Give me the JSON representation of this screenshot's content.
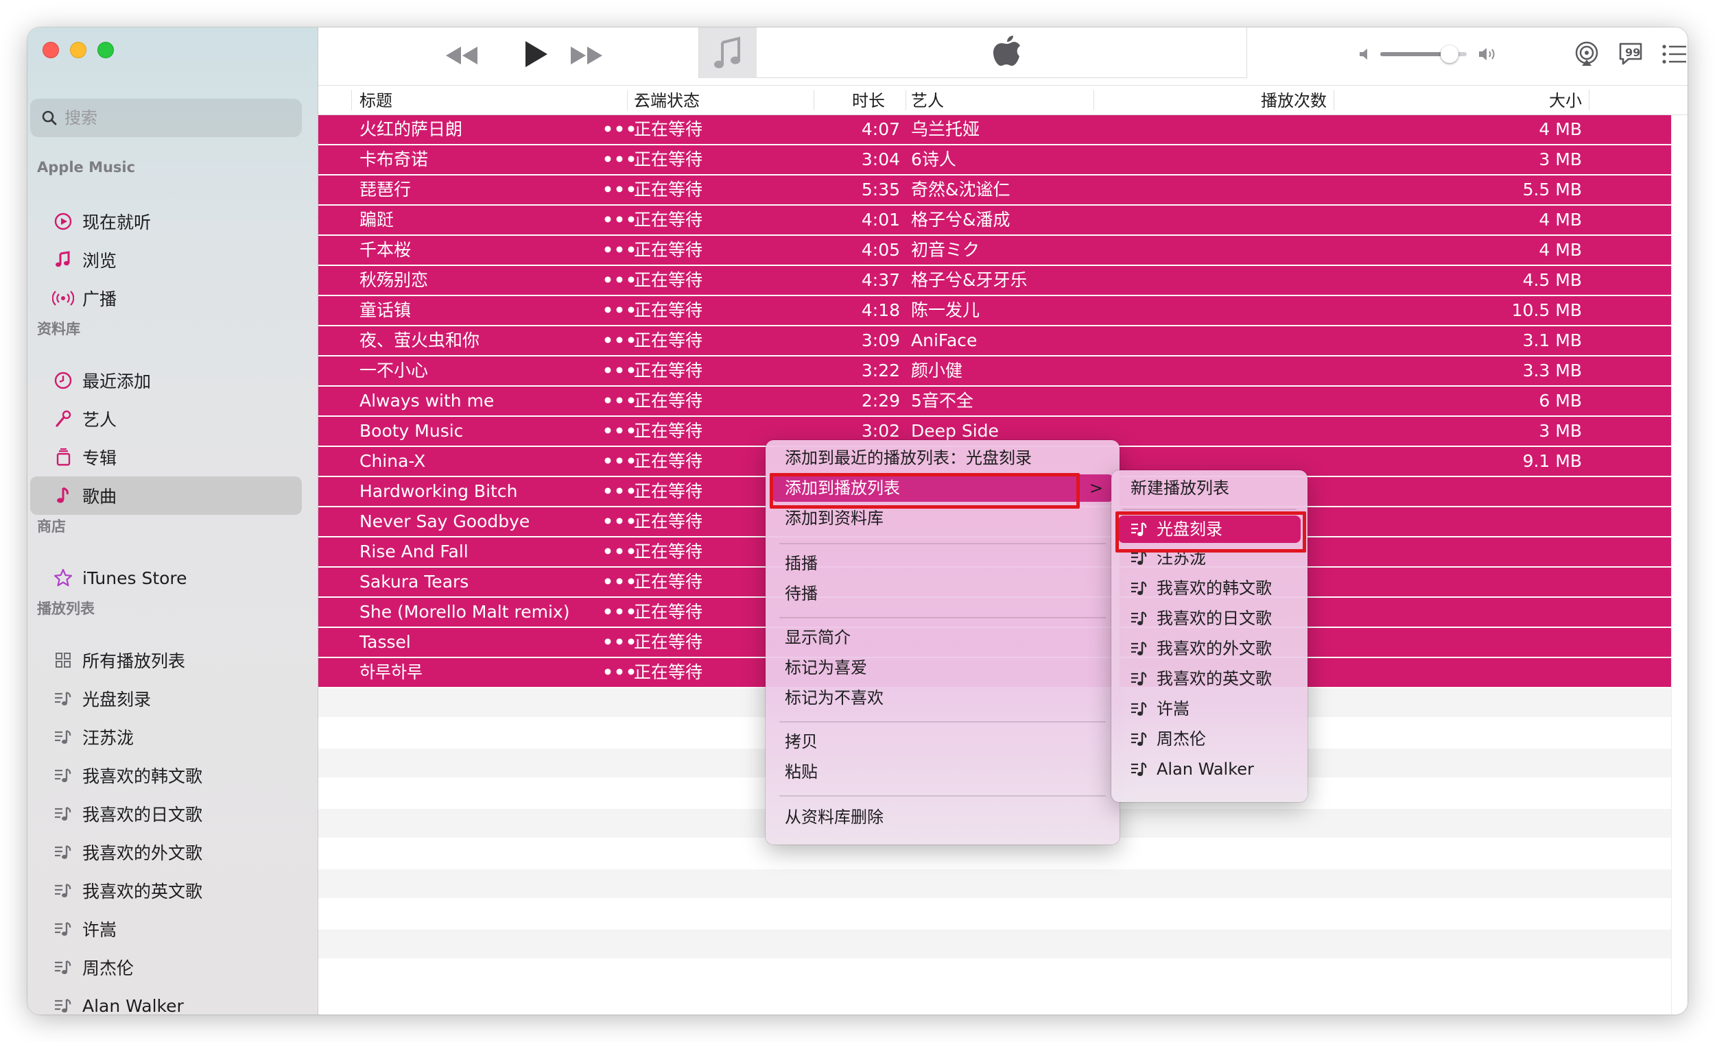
{
  "colors": {
    "accent": "#d11a6e",
    "highlight_box": "#e0151f",
    "sidebar_bg": "#e4e4e6",
    "traffic_red": "#ff5f57",
    "traffic_yellow": "#febc2e",
    "traffic_green": "#28c840"
  },
  "sidebar": {
    "search_placeholder": "搜索",
    "sections": [
      {
        "title": "Apple Music",
        "items": [
          {
            "label": "现在就听",
            "icon": "play-circle-icon"
          },
          {
            "label": "浏览",
            "icon": "music-note-icon"
          },
          {
            "label": "广播",
            "icon": "radio-waves-icon"
          }
        ]
      },
      {
        "title": "资料库",
        "items": [
          {
            "label": "最近添加",
            "icon": "clock-icon"
          },
          {
            "label": "艺人",
            "icon": "microphone-icon"
          },
          {
            "label": "专辑",
            "icon": "album-stack-icon"
          },
          {
            "label": "歌曲",
            "icon": "music-note-icon",
            "selected": true
          }
        ]
      },
      {
        "title": "商店",
        "items": [
          {
            "label": "iTunes Store",
            "icon": "star-icon"
          }
        ]
      },
      {
        "title": "播放列表",
        "items": [
          {
            "label": "所有播放列表",
            "icon": "grid-icon"
          },
          {
            "label": "光盘刻录",
            "icon": "playlist-icon"
          },
          {
            "label": "汪苏泷",
            "icon": "playlist-icon"
          },
          {
            "label": "我喜欢的韩文歌",
            "icon": "playlist-icon"
          },
          {
            "label": "我喜欢的日文歌",
            "icon": "playlist-icon"
          },
          {
            "label": "我喜欢的外文歌",
            "icon": "playlist-icon"
          },
          {
            "label": "我喜欢的英文歌",
            "icon": "playlist-icon"
          },
          {
            "label": "许嵩",
            "icon": "playlist-icon"
          },
          {
            "label": "周杰伦",
            "icon": "playlist-icon"
          },
          {
            "label": "Alan Walker",
            "icon": "playlist-icon"
          }
        ]
      }
    ]
  },
  "toolbar": {
    "volume_level": 0.8
  },
  "columns": {
    "title": "标题",
    "sort_indicator": "^",
    "cloud_status": "云端状态",
    "duration": "时长",
    "artist": "艺人",
    "plays": "播放次数",
    "size": "大小"
  },
  "tracks": [
    {
      "title": "火红的萨日朗",
      "status": "正在等待",
      "duration": "4:07",
      "artist": "乌兰托娅",
      "size": "4 MB"
    },
    {
      "title": "卡布奇诺",
      "status": "正在等待",
      "duration": "3:04",
      "artist": "6诗人",
      "size": "3 MB"
    },
    {
      "title": "琵琶行",
      "status": "正在等待",
      "duration": "5:35",
      "artist": "奇然&沈谧仁",
      "size": "5.5 MB"
    },
    {
      "title": "蹁跹",
      "status": "正在等待",
      "duration": "4:01",
      "artist": "格子兮&潘成",
      "size": "4 MB"
    },
    {
      "title": "千本桜",
      "status": "正在等待",
      "duration": "4:05",
      "artist": "初音ミク",
      "size": "4 MB"
    },
    {
      "title": "秋殇别恋",
      "status": "正在等待",
      "duration": "4:37",
      "artist": "格子兮&牙牙乐",
      "size": "4.5 MB"
    },
    {
      "title": "童话镇",
      "status": "正在等待",
      "duration": "4:18",
      "artist": "陈一发儿",
      "size": "10.5 MB"
    },
    {
      "title": "夜、萤火虫和你",
      "status": "正在等待",
      "duration": "3:09",
      "artist": "AniFace",
      "size": "3.1 MB"
    },
    {
      "title": "一不小心",
      "status": "正在等待",
      "duration": "3:22",
      "artist": "颜小健",
      "size": "3.3 MB"
    },
    {
      "title": "Always with me",
      "status": "正在等待",
      "duration": "2:29",
      "artist": "5音不全",
      "size": "6 MB"
    },
    {
      "title": "Booty Music",
      "status": "正在等待",
      "duration": "3:02",
      "artist": "Deep Side",
      "size": "3 MB"
    },
    {
      "title": "China-X",
      "status": "正在等待",
      "duration": "",
      "artist": "",
      "size": "9.1 MB"
    },
    {
      "title": "Hardworking Bitch",
      "status": "正在等待",
      "duration": "",
      "artist": "",
      "size": ""
    },
    {
      "title": "Never Say Goodbye",
      "status": "正在等待",
      "duration": "",
      "artist": "",
      "size": ""
    },
    {
      "title": "Rise And Fall",
      "status": "正在等待",
      "duration": "",
      "artist": "",
      "size": ""
    },
    {
      "title": "Sakura Tears",
      "status": "正在等待",
      "duration": "",
      "artist": "",
      "size": ""
    },
    {
      "title": "She (Morello Malt remix)",
      "status": "正在等待",
      "duration": "",
      "artist": "",
      "size": ""
    },
    {
      "title": "Tassel",
      "status": "正在等待",
      "duration": "",
      "artist": "",
      "size": ""
    },
    {
      "title": "하루하루",
      "status": "正在等待",
      "duration": "",
      "artist": "",
      "size": ""
    }
  ],
  "more_glyph": "•••",
  "context_menu": {
    "add_to_recent": "添加到最近的播放列表：光盘刻录",
    "add_to_playlist": "添加到播放列表",
    "add_to_library": "添加到资料库",
    "play_next": "插播",
    "play_later": "待播",
    "get_info": "显示简介",
    "love": "标记为喜爱",
    "dislike": "标记为不喜欢",
    "copy": "拷贝",
    "paste": "粘贴",
    "delete_from_library": "从资料库删除",
    "submenu_chevron": ">"
  },
  "playlist_submenu": {
    "new_playlist": "新建播放列表",
    "playlists": [
      "光盘刻录",
      "汪苏泷",
      "我喜欢的韩文歌",
      "我喜欢的日文歌",
      "我喜欢的外文歌",
      "我喜欢的英文歌",
      "许嵩",
      "周杰伦",
      "Alan Walker"
    ]
  }
}
